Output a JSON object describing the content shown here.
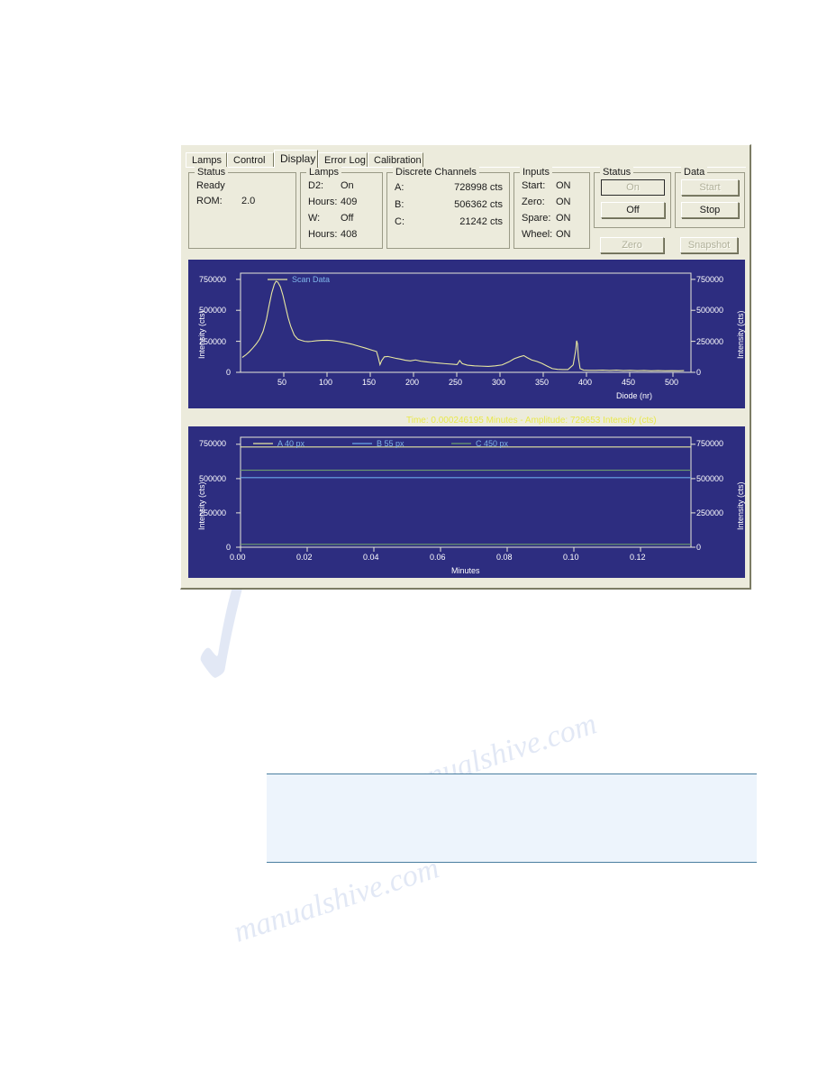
{
  "dialog": {
    "tabs": [
      {
        "label": "Lamps",
        "active": false
      },
      {
        "label": "Control",
        "active": false
      },
      {
        "label": "Display",
        "active": true
      },
      {
        "label": "Error Log",
        "active": false
      },
      {
        "label": "Calibration",
        "active": false
      }
    ],
    "groups": {
      "status": {
        "title": "Status",
        "state": "Ready",
        "rom_label": "ROM:",
        "rom_value": "2.0"
      },
      "lamps": {
        "title": "Lamps",
        "rows": [
          {
            "key": "D2:",
            "value": "On"
          },
          {
            "key": "Hours:",
            "value": "409"
          },
          {
            "key": "W:",
            "value": "Off"
          },
          {
            "key": "Hours:",
            "value": "408"
          }
        ]
      },
      "discrete_channels": {
        "title": "Discrete Channels",
        "rows": [
          {
            "key": "A:",
            "value": "728998 cts"
          },
          {
            "key": "B:",
            "value": "506362 cts"
          },
          {
            "key": "C:",
            "value": "21242 cts"
          }
        ]
      },
      "inputs": {
        "title": "Inputs",
        "rows": [
          {
            "key": "Start:",
            "value": "ON"
          },
          {
            "key": "Zero:",
            "value": "ON"
          },
          {
            "key": "Spare:",
            "value": "ON"
          },
          {
            "key": "Wheel:",
            "value": "ON"
          }
        ]
      },
      "status_buttons": {
        "title": "Status",
        "on": "On",
        "off": "Off"
      },
      "data_buttons": {
        "title": "Data",
        "start": "Start",
        "stop": "Stop"
      },
      "extra_buttons": {
        "zero": "Zero",
        "snapshot": "Snapshot"
      }
    },
    "readout": "Time:  0.000246195 Minutes - Amplitude:  729653 Intensity (cts)",
    "colors": {
      "dialog_face": "#ECEBDC",
      "plot_background": "#2D2D80",
      "trace_yellow": "#E8E8A0",
      "trace_blue": "#6CA8E8",
      "trace_green": "#6E9E6E",
      "legend_text": "#7FB4E8",
      "readout_text": "#E8E84C"
    }
  },
  "chart_data": [
    {
      "type": "line",
      "id": "scan-chart",
      "title": "",
      "xlabel": "Diode (nr)",
      "ylabel": "Intensity (cts)",
      "ylabel_right": "Intensity (cts)",
      "xlim": [
        0,
        520
      ],
      "ylim": [
        0,
        800000
      ],
      "xticks": [
        50,
        100,
        150,
        200,
        250,
        300,
        350,
        400,
        450,
        500
      ],
      "yticks": [
        0,
        250000,
        500000,
        750000
      ],
      "ytick_labels": [
        "0",
        "250000",
        "500000",
        "750000"
      ],
      "grid": false,
      "legend": [
        {
          "name": "Scan Data",
          "color": "#E8E8A0"
        }
      ],
      "series": [
        {
          "name": "Scan Data",
          "color": "#E8E8A0",
          "x": [
            2,
            6,
            10,
            14,
            18,
            22,
            26,
            30,
            33,
            36,
            39,
            41,
            43,
            46,
            49,
            52,
            55,
            58,
            62,
            66,
            70,
            74,
            78,
            82,
            88,
            94,
            100,
            106,
            112,
            120,
            128,
            136,
            144,
            152,
            157,
            159,
            161,
            163,
            166,
            170,
            175,
            180,
            185,
            190,
            196,
            202,
            208,
            214,
            220,
            228,
            236,
            244,
            250,
            253,
            256,
            262,
            270,
            278,
            286,
            294,
            302,
            310,
            316,
            322,
            327,
            331,
            336,
            342,
            348,
            354,
            360,
            366,
            372,
            378,
            384,
            387,
            388,
            389,
            390,
            392,
            396,
            402,
            410,
            418,
            426,
            434,
            442,
            450,
            458,
            466,
            474,
            482,
            490,
            498,
            506,
            512
          ],
          "y": [
            120000,
            140000,
            165000,
            195000,
            228000,
            268000,
            330000,
            430000,
            540000,
            640000,
            710000,
            735000,
            728000,
            690000,
            620000,
            530000,
            440000,
            370000,
            300000,
            268000,
            258000,
            250000,
            248000,
            250000,
            255000,
            258000,
            259000,
            256000,
            250000,
            240000,
            228000,
            212000,
            196000,
            178000,
            168000,
            120000,
            62000,
            95000,
            125000,
            128000,
            120000,
            112000,
            106000,
            98000,
            92000,
            100000,
            90000,
            85000,
            80000,
            75000,
            70000,
            66000,
            62000,
            95000,
            70000,
            58000,
            52000,
            50000,
            48000,
            52000,
            60000,
            85000,
            110000,
            125000,
            135000,
            118000,
            100000,
            88000,
            72000,
            50000,
            30000,
            24000,
            22000,
            22000,
            60000,
            180000,
            255000,
            230000,
            120000,
            30000,
            18000,
            16000,
            16000,
            18000,
            15000,
            18000,
            14000,
            16000,
            13000,
            15000,
            12000,
            14000,
            12000,
            13000,
            12000,
            14000
          ]
        }
      ]
    },
    {
      "type": "line",
      "id": "trend-chart",
      "title": "",
      "xlabel": "Minutes",
      "ylabel": "Intensity (cts)",
      "ylabel_right": "Intensity (cts)",
      "xlim": [
        0.0,
        0.135
      ],
      "ylim": [
        0,
        800000
      ],
      "xticks": [
        0.0,
        0.02,
        0.04,
        0.06,
        0.08,
        0.1,
        0.12
      ],
      "xtick_labels": [
        "0.00",
        "0.02",
        "0.04",
        "0.06",
        "0.08",
        "0.10",
        "0.12"
      ],
      "yticks": [
        0,
        250000,
        500000,
        750000
      ],
      "ytick_labels": [
        "0",
        "250000",
        "500000",
        "750000"
      ],
      "grid": false,
      "legend": [
        {
          "name": "A 40 px",
          "color": "#E8E8A0"
        },
        {
          "name": "B 55 px",
          "color": "#6CA8E8"
        },
        {
          "name": "C 450 px",
          "color": "#6E9E6E"
        }
      ],
      "series": [
        {
          "name": "A 40 px",
          "color": "#E8E8A0",
          "constant_value": 729000
        },
        {
          "name": "B 55 px",
          "color": "#6CA8E8",
          "constant_value": 506000
        },
        {
          "name": "C 450 px",
          "color": "#6E9E6E",
          "constant_value": 21000
        },
        {
          "name": "trace-upper-green",
          "color": "#6E9E6E",
          "constant_value": 560000
        }
      ]
    }
  ],
  "notebox": {
    "text": ""
  },
  "watermark": {
    "lines": [
      "manualshive.com",
      "manualshive.com"
    ]
  }
}
